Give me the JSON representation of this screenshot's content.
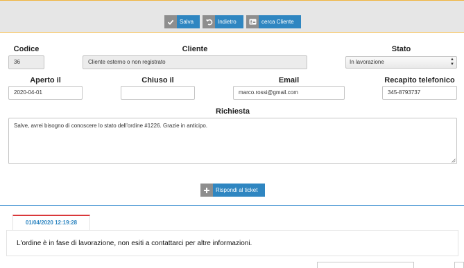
{
  "toolbar": {
    "save_label": "Salva",
    "back_label": "Indietro",
    "search_client_label": "cerca Cliente"
  },
  "form": {
    "codice": {
      "label": "Codice",
      "value": "36"
    },
    "cliente": {
      "label": "Cliente",
      "value": "Cliente esterno o non registrato"
    },
    "stato": {
      "label": "Stato",
      "value": "In lavorazione"
    },
    "aperto_il": {
      "label": "Aperto il",
      "value": "2020-04-01"
    },
    "chiuso_il": {
      "label": "Chiuso il",
      "value": ""
    },
    "email": {
      "label": "Email",
      "value": "marco.rossi@gmail.com"
    },
    "recapito": {
      "label": "Recapito telefonico",
      "value": "345-8793737"
    },
    "richiesta": {
      "label": "Richiesta",
      "value": "Salve, avrei bisogno di conoscere lo stato dell'ordine #1226. Grazie in anticipo."
    }
  },
  "reply_button_label": "Rispondi al ticket",
  "response": {
    "timestamp": "01/04/2020 12:19:28",
    "message": "L'ordine è in fase di lavorazione, non esiti a contattarci per altre informazioni."
  },
  "colors": {
    "accent": "#2f86c1",
    "toolbar_border": "#f0b43c",
    "tab_border": "#d9383a",
    "icon_bg": "#8e8e8e"
  }
}
